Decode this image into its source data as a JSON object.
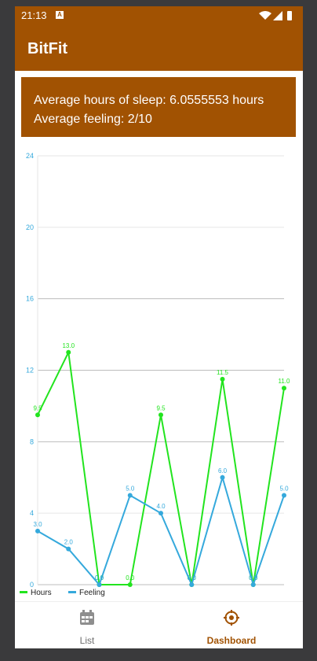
{
  "status_bar": {
    "time": "21:13",
    "notification_badge": "A"
  },
  "app": {
    "title": "BitFit"
  },
  "summary": {
    "avg_sleep": "Average hours of sleep: 6.0555553 hours",
    "avg_feeling": "Average feeling: 2/10"
  },
  "nav": {
    "list_label": "List",
    "dashboard_label": "Dashboard",
    "active": "dashboard"
  },
  "colors": {
    "brand": "#a15202",
    "hours_series": "#22e41e",
    "feeling_series": "#35a9dc",
    "axis_label": "#35a9dc"
  },
  "chart_data": {
    "type": "line",
    "x": [
      1,
      2,
      3,
      4,
      5,
      6,
      7,
      8,
      9
    ],
    "ylim": [
      0,
      24
    ],
    "yticks": [
      "0",
      "4",
      "8",
      "12",
      "16",
      "20",
      "24"
    ],
    "series": [
      {
        "name": "Hours",
        "values": [
          9.5,
          13.0,
          0.0,
          0.0,
          9.5,
          0.0,
          11.5,
          0.0,
          11.0
        ],
        "labels": [
          "9.5",
          "13.0",
          "0.0",
          "0.0",
          "9.5",
          "0.0",
          "11.5",
          "0.0",
          "11.0"
        ]
      },
      {
        "name": "Feeling",
        "values": [
          3.0,
          2.0,
          0.0,
          5.0,
          4.0,
          0.0,
          6.0,
          0.0,
          5.0
        ],
        "labels": [
          "3.0",
          "2.0",
          "0.0",
          "5.0",
          "4.0",
          "0.0",
          "6.0",
          "0.0",
          "5.0"
        ]
      }
    ],
    "legend": "bottom-left",
    "grid": true
  }
}
